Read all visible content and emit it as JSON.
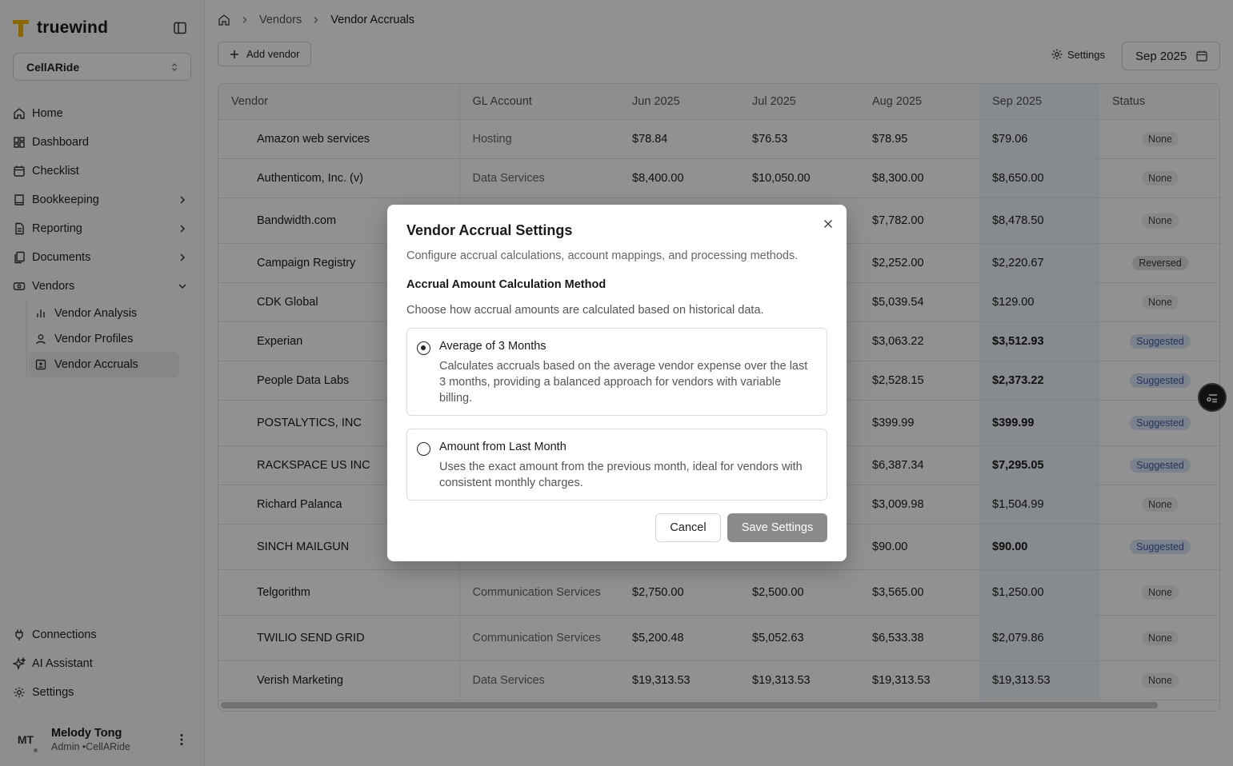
{
  "brand": {
    "name": "truewind",
    "accent": "#f5b700"
  },
  "org_select": {
    "value": "CellARide"
  },
  "nav": {
    "items": [
      {
        "label": "Home"
      },
      {
        "label": "Dashboard"
      },
      {
        "label": "Checklist"
      },
      {
        "label": "Bookkeeping"
      },
      {
        "label": "Reporting"
      },
      {
        "label": "Documents"
      },
      {
        "label": "Vendors"
      }
    ],
    "sub_items": [
      {
        "label": "Vendor Analysis"
      },
      {
        "label": "Vendor Profiles"
      },
      {
        "label": "Vendor Accruals"
      }
    ],
    "bottom_items": [
      {
        "label": "Connections"
      },
      {
        "label": "AI Assistant"
      },
      {
        "label": "Settings"
      }
    ]
  },
  "user": {
    "initials": "MT",
    "name": "Melody Tong",
    "role": "Admin •CellARide"
  },
  "breadcrumb": {
    "parent": "Vendors",
    "current": "Vendor Accruals"
  },
  "toolbar": {
    "add_vendor": "Add vendor",
    "settings": "Settings",
    "month": "Sep 2025"
  },
  "table": {
    "headers": [
      "Vendor",
      "GL Account",
      "Jun 2025",
      "Jul 2025",
      "Aug 2025",
      "Sep 2025",
      "Status"
    ],
    "rows": [
      {
        "vendor": "Amazon web services",
        "gl": "Hosting",
        "jun": "$78.84",
        "jul": "$76.53",
        "aug": "$78.95",
        "sep": "$79.06",
        "status": "None"
      },
      {
        "vendor": "Authenticom, Inc. (v)",
        "gl": "Data Services",
        "jun": "$8,400.00",
        "jul": "$10,050.00",
        "aug": "$8,300.00",
        "sep": "$8,650.00",
        "status": "None"
      },
      {
        "vendor": "Bandwidth.com",
        "gl": "",
        "jun": "",
        "jul": "",
        "aug": "$7,782.00",
        "sep": "$8,478.50",
        "status": "None"
      },
      {
        "vendor": "Campaign Registry",
        "gl": "",
        "jun": "",
        "jul": "",
        "aug": "$2,252.00",
        "sep": "$2,220.67",
        "status": "Reversed"
      },
      {
        "vendor": "CDK Global",
        "gl": "",
        "jun": "",
        "jul": "",
        "aug": "$5,039.54",
        "sep": "$129.00",
        "status": "None"
      },
      {
        "vendor": "Experian",
        "gl": "",
        "jun": "",
        "jul": "",
        "aug": "$3,063.22",
        "sep": "$3,512.93",
        "status": "Suggested"
      },
      {
        "vendor": "People Data Labs",
        "gl": "",
        "jun": "",
        "jul": "",
        "aug": "$2,528.15",
        "sep": "$2,373.22",
        "status": "Suggested"
      },
      {
        "vendor": "POSTALYTICS, INC",
        "gl": "",
        "jun": "",
        "jul": "",
        "aug": "$399.99",
        "sep": "$399.99",
        "status": "Suggested"
      },
      {
        "vendor": "RACKSPACE US INC",
        "gl": "",
        "jun": "",
        "jul": "",
        "aug": "$6,387.34",
        "sep": "$7,295.05",
        "status": "Suggested"
      },
      {
        "vendor": "Richard Palanca",
        "gl": "",
        "jun": "",
        "jul": "",
        "aug": "$3,009.98",
        "sep": "$1,504.99",
        "status": "None"
      },
      {
        "vendor": "SINCH MAILGUN",
        "gl": "",
        "jun": "",
        "jul": "",
        "aug": "$90.00",
        "sep": "$90.00",
        "status": "Suggested"
      },
      {
        "vendor": "Telgorithm",
        "gl": "Communication Services",
        "jun": "$2,750.00",
        "jul": "$2,500.00",
        "aug": "$3,565.00",
        "sep": "$1,250.00",
        "status": "None"
      },
      {
        "vendor": "TWILIO SEND GRID",
        "gl": "Communication Services",
        "jun": "$5,200.48",
        "jul": "$5,052.63",
        "aug": "$6,533.38",
        "sep": "$2,079.86",
        "status": "None"
      },
      {
        "vendor": "Verish Marketing",
        "gl": "Data Services",
        "jun": "$19,313.53",
        "jul": "$19,313.53",
        "aug": "$19,313.53",
        "sep": "$19,313.53",
        "status": "None"
      }
    ]
  },
  "modal": {
    "title": "Vendor Accrual Settings",
    "description": "Configure accrual calculations, account mappings, and processing methods.",
    "section_title": "Accrual Amount Calculation Method",
    "section_description": "Choose how accrual amounts are calculated based on historical data.",
    "options": [
      {
        "title": "Average of 3 Months",
        "description": "Calculates accruals based on the average vendor expense over the last 3 months, providing a balanced approach for vendors with variable billing.",
        "selected": true
      },
      {
        "title": "Amount from Last Month",
        "description": "Uses the exact amount from the previous month, ideal for vendors with consistent monthly charges.",
        "selected": false
      }
    ],
    "cancel_label": "Cancel",
    "save_label": "Save Settings"
  }
}
